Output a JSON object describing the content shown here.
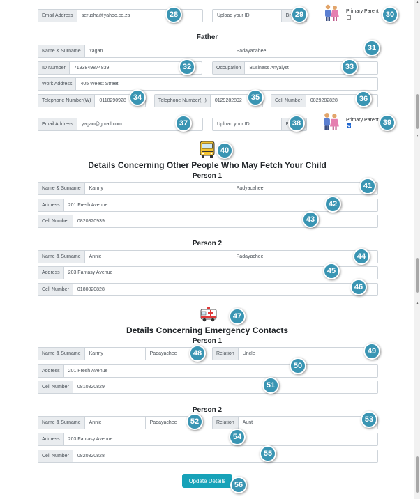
{
  "mother": {
    "email_label": "Email Address",
    "email_value": "serusha@yahoo.co.za",
    "upload_placeholder": "Upload your ID",
    "browse_label": "Browse",
    "primary_parent_label": "Primary Parent",
    "primary_parent_checked": false
  },
  "father": {
    "title": "Father",
    "name_label": "Name & Surname",
    "first_name": "Yagan",
    "surname": "Padayacahee",
    "id_label": "ID Number",
    "id_value": "7193849874839",
    "occupation_label": "Occupation",
    "occupation_value": "Business Anyalyst",
    "work_label": "Work Address",
    "work_value": "405 Weest Street",
    "tel_w_label": "Telephone Number(W)",
    "tel_w_value": "0118290928",
    "tel_h_label": "Telephone Number(H)",
    "tel_h_value": "0129282892",
    "cell_label": "Cell Number",
    "cell_value": "0829282828",
    "email_label": "Email Address",
    "email_value": "yagan@gmail.com",
    "upload_placeholder": "Upload your ID",
    "browse_label": "Browse",
    "primary_parent_label": "Primary Parent",
    "primary_parent_checked": true
  },
  "fetch": {
    "title": "Details Concerning Other People Who May Fetch Your Child",
    "icon": "school-bus-icon",
    "persons": [
      {
        "heading": "Person 1",
        "name_label": "Name & Surname",
        "first_name": "Karmy",
        "surname": "Padyacahee",
        "address_label": "Address",
        "address": "201 Fresh Avenue",
        "cell_label": "Cell Number",
        "cell": "0820820939"
      },
      {
        "heading": "Person 2",
        "name_label": "Name & Surname",
        "first_name": "Annie",
        "surname": "Padayachee",
        "address_label": "Address",
        "address": "203 Fantasy Avenue",
        "cell_label": "Cell Number",
        "cell": "0180820828"
      }
    ]
  },
  "emergency": {
    "title": "Details Concerning Emergency Contacts",
    "icon": "ambulance-icon",
    "persons": [
      {
        "heading": "Person 1",
        "name_label": "Name & Surname",
        "first_name": "Karmy",
        "surname": "Padayachee",
        "relation_label": "Relation",
        "relation": "Uncle",
        "address_label": "Address",
        "address": "201 Fresh Avenue",
        "cell_label": "Cell Number",
        "cell": "0810820829"
      },
      {
        "heading": "Person 2",
        "name_label": "Name & Surname",
        "first_name": "Annie",
        "surname": "Padayachee",
        "relation_label": "Relation",
        "relation": "Aunt",
        "address_label": "Address",
        "address": "203 Fantasy Avenue",
        "cell_label": "Cell Number",
        "cell": "0820820828"
      }
    ]
  },
  "update_button": "Update Details",
  "badges": [
    "28",
    "29",
    "30",
    "31",
    "32",
    "33",
    "34",
    "35",
    "36",
    "37",
    "38",
    "39",
    "40",
    "41",
    "42",
    "43",
    "44",
    "45",
    "46",
    "47",
    "48",
    "49",
    "50",
    "51",
    "52",
    "53",
    "54",
    "55",
    "56"
  ],
  "colors": {
    "badge": "#3a95b3",
    "button": "#17a2b8",
    "label_bg": "#e9ecef",
    "border": "#ced4da"
  }
}
